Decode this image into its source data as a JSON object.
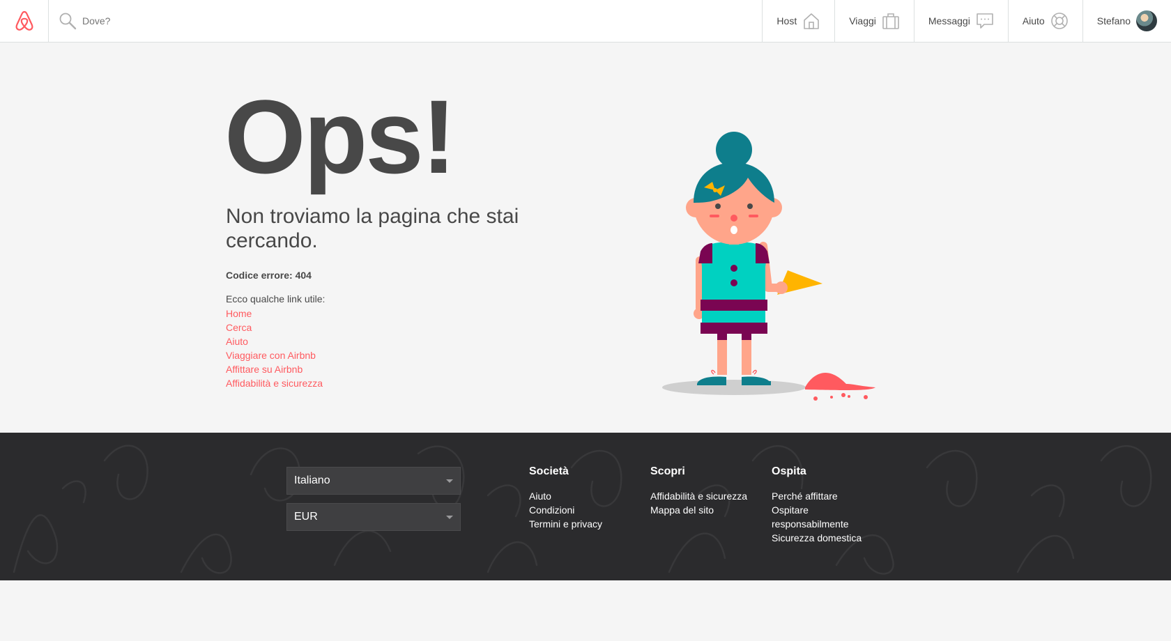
{
  "header": {
    "search_placeholder": "Dove?",
    "nav": [
      {
        "label": "Host",
        "icon": "house-icon"
      },
      {
        "label": "Viaggi",
        "icon": "suitcase-icon"
      },
      {
        "label": "Messaggi",
        "icon": "speech-bubble-icon"
      },
      {
        "label": "Aiuto",
        "icon": "lifebuoy-icon"
      },
      {
        "label": "Stefano",
        "icon": "avatar"
      }
    ]
  },
  "main": {
    "headline": "Ops!",
    "subtitle": "Non troviamo la pagina che stai cercando.",
    "error_code": "Codice errore: 404",
    "links_intro": "Ecco qualche link utile:",
    "links": [
      "Home",
      "Cerca",
      "Aiuto",
      "Viaggiare con Airbnb",
      "Affittare su Airbnb",
      "Affidabilità e sicurezza"
    ]
  },
  "footer": {
    "language": "Italiano",
    "currency": "EUR",
    "columns": [
      {
        "title": "Società",
        "items": [
          "Aiuto",
          "Condizioni",
          "Termini e privacy"
        ]
      },
      {
        "title": "Scopri",
        "items": [
          "Affidabilità e sicurezza",
          "Mappa del sito"
        ]
      },
      {
        "title": "Ospita",
        "items": [
          "Perché affittare",
          "Ospitare",
          "responsabilmente",
          "Sicurezza domestica"
        ]
      }
    ]
  },
  "colors": {
    "brand": "#ff5a5f",
    "text": "#484848",
    "footer_bg": "#2b2b2d",
    "page_bg": "#f5f5f5"
  }
}
